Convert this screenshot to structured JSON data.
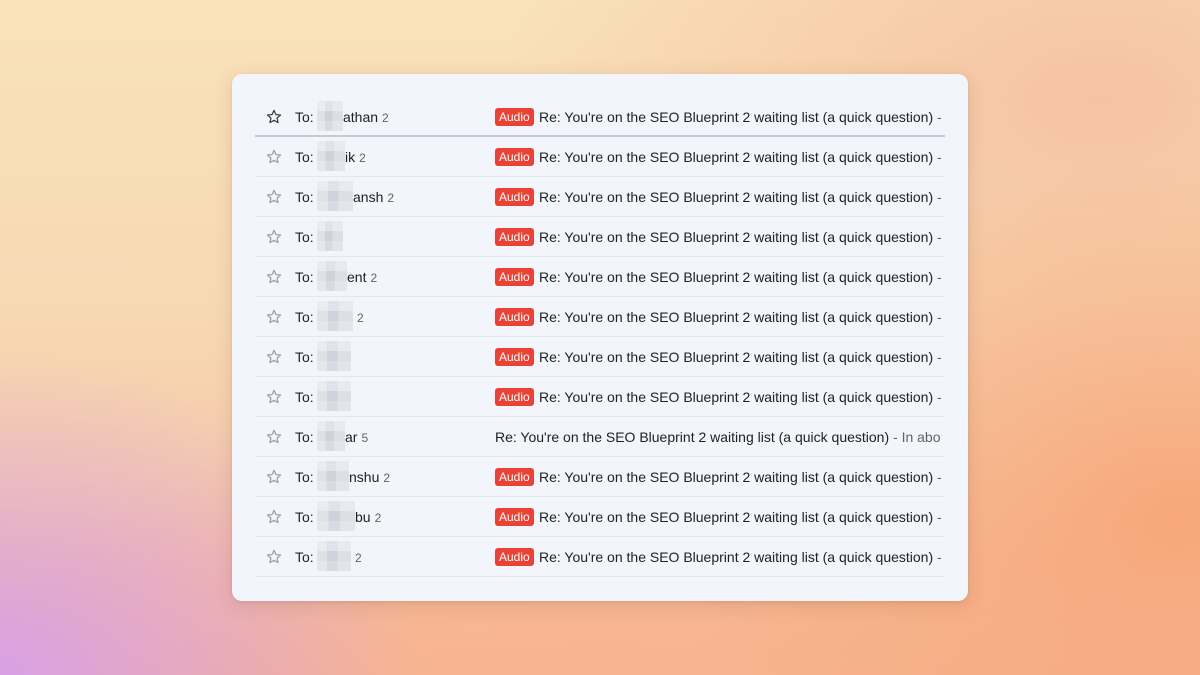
{
  "colors": {
    "card_background": "#f2f6fc",
    "badge_background": "#ea4335",
    "badge_text": "#ffffff",
    "snippet_text": "#5f6368"
  },
  "rows": [
    {
      "to": "To:",
      "name": "athan",
      "count": "2",
      "badge": "Audio",
      "subject": "Re: You're on the SEO Blueprint 2 waiting list (a quick question)",
      "snippet": " -",
      "active": true,
      "star_icon": "star-outline-icon"
    },
    {
      "to": "To:",
      "name": "ik",
      "count": "2",
      "badge": "Audio",
      "subject": "Re: You're on the SEO Blueprint 2 waiting list (a quick question)",
      "snippet": " -",
      "star_icon": "star-outline-icon"
    },
    {
      "to": "To:",
      "name": "ansh",
      "count": "2",
      "badge": "Audio",
      "subject": "Re: You're on the SEO Blueprint 2 waiting list (a quick question)",
      "snippet": " -",
      "star_icon": "star-outline-icon"
    },
    {
      "to": "To:",
      "name": "",
      "count": "",
      "badge": "Audio",
      "subject": "Re: You're on the SEO Blueprint 2 waiting list (a quick question)",
      "snippet": " -",
      "star_icon": "star-outline-icon"
    },
    {
      "to": "To:",
      "name": "ent",
      "count": "2",
      "badge": "Audio",
      "subject": "Re: You're on the SEO Blueprint 2 waiting list (a quick question)",
      "snippet": " -",
      "star_icon": "star-outline-icon"
    },
    {
      "to": "To:",
      "name": "",
      "count": "2",
      "badge": "Audio",
      "subject": "Re: You're on the SEO Blueprint 2 waiting list (a quick question)",
      "snippet": " -",
      "star_icon": "star-outline-icon"
    },
    {
      "to": "To:",
      "name": "",
      "count": "",
      "badge": "Audio",
      "subject": "Re: You're on the SEO Blueprint 2 waiting list (a quick question)",
      "snippet": " -",
      "star_icon": "star-outline-icon"
    },
    {
      "to": "To:",
      "name": "",
      "count": "",
      "badge": "Audio",
      "subject": "Re: You're on the SEO Blueprint 2 waiting list (a quick question)",
      "snippet": " -",
      "star_icon": "star-outline-icon"
    },
    {
      "to": "To:",
      "name": "ar",
      "count": "5",
      "badge": "",
      "subject": "Re: You're on the SEO Blueprint 2 waiting list (a quick question)",
      "snippet": " - In abo",
      "star_icon": "star-outline-icon"
    },
    {
      "to": "To:",
      "name": "nshu",
      "count": "2",
      "badge": "Audio",
      "subject": "Re: You're on the SEO Blueprint 2 waiting list (a quick question)",
      "snippet": " -",
      "star_icon": "star-outline-icon"
    },
    {
      "to": "To:",
      "name": "bu",
      "count": "2",
      "badge": "Audio",
      "subject": "Re: You're on the SEO Blueprint 2 waiting list (a quick question)",
      "snippet": " -",
      "star_icon": "star-outline-icon"
    },
    {
      "to": "To:",
      "name": "",
      "count": "2",
      "badge": "Audio",
      "subject": "Re: You're on the SEO Blueprint 2 waiting list (a quick question)",
      "snippet": " -",
      "star_icon": "star-outline-icon"
    }
  ]
}
